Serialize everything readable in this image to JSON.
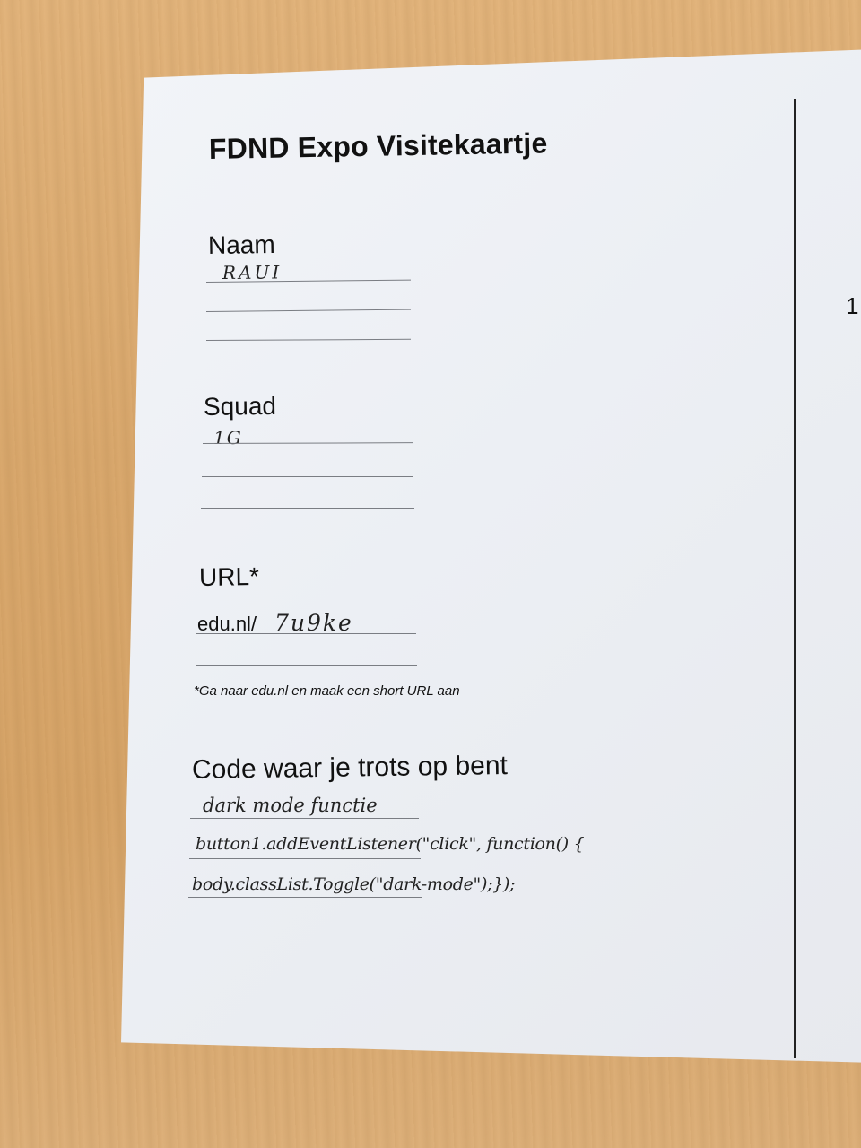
{
  "card": {
    "title": "FDND Expo Visitekaartje",
    "edge_number": "1",
    "name_label": "Naam",
    "name_value": "RAUI",
    "squad_label": "Squad",
    "squad_value": "1G",
    "url_label": "URL*",
    "url_prefix": "edu.nl/",
    "url_value": "7u9ke",
    "url_note": "*Ga naar edu.nl en maak een short URL aan",
    "code_label": "Code waar je trots op bent",
    "code_lines": [
      "dark mode functie",
      "button1.addEventListener(\"click\", function() {",
      "body.classList.Toggle(\"dark-mode\");});"
    ]
  }
}
